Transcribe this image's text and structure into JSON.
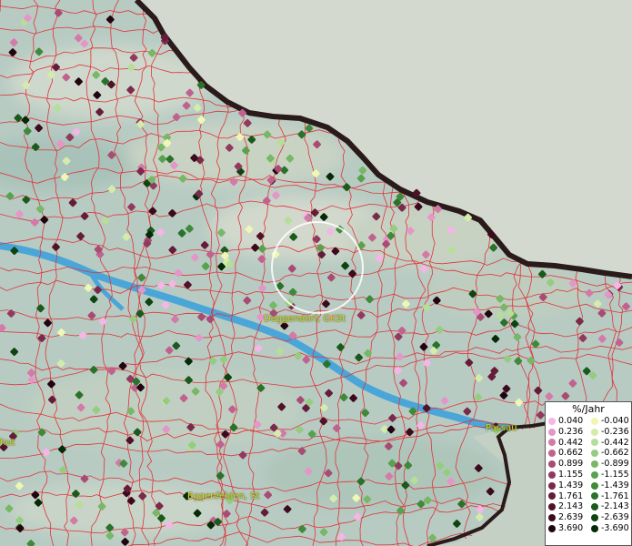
{
  "map": {
    "places": [
      {
        "name": "Deggendorf, GKSt",
        "id": "place-deggendorf"
      },
      {
        "name": "Passau",
        "id": "place-passau"
      },
      {
        "name": "Eggenfelden, St",
        "id": "place-eggenfelden"
      },
      {
        "name": "hut",
        "id": "place-landshut"
      }
    ]
  },
  "legend": {
    "title": "%/Jahr",
    "positive": [
      {
        "label": "0.040",
        "color": "#f4b6e6"
      },
      {
        "label": "0.236",
        "color": "#e596c8"
      },
      {
        "label": "0.442",
        "color": "#d47aa8"
      },
      {
        "label": "0.662",
        "color": "#c1628e"
      },
      {
        "label": "0.899",
        "color": "#a84c74"
      },
      {
        "label": "1.155",
        "color": "#913a5e"
      },
      {
        "label": "1.439",
        "color": "#7a2a4a"
      },
      {
        "label": "1.761",
        "color": "#651c38"
      },
      {
        "label": "2.143",
        "color": "#511228"
      },
      {
        "label": "2.639",
        "color": "#3c0a1c"
      },
      {
        "label": "3.690",
        "color": "#220410"
      }
    ],
    "negative": [
      {
        "label": "-0.040",
        "color": "#eef7b4"
      },
      {
        "label": "-0.236",
        "color": "#d3ecac"
      },
      {
        "label": "-0.442",
        "color": "#b6de98"
      },
      {
        "label": "-0.662",
        "color": "#96cc80"
      },
      {
        "label": "-0.899",
        "color": "#76b866"
      },
      {
        "label": "-1.155",
        "color": "#58a24e"
      },
      {
        "label": "-1.439",
        "color": "#3e8a3a"
      },
      {
        "label": "-1.761",
        "color": "#2a722a"
      },
      {
        "label": "-2.143",
        "color": "#1a5a1c"
      },
      {
        "label": "-2.639",
        "color": "#0e4410"
      },
      {
        "label": "-3.690",
        "color": "#052a06"
      }
    ]
  },
  "colors": {
    "border_line": "#2a1a1a",
    "boundaries": "#e0333a",
    "river": "#4aa6d8",
    "lowland": "#b9cdc4",
    "upland": "#d6dcd2",
    "label": "#d8d81a"
  }
}
